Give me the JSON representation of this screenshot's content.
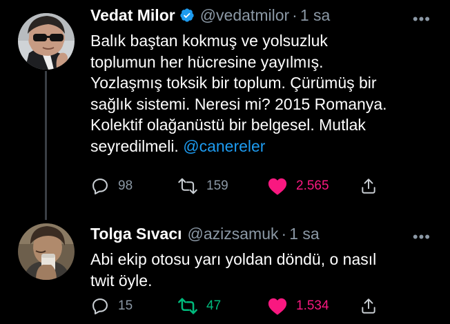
{
  "tweets": [
    {
      "name": "Vedat Milor",
      "handle": "@vedatmilor",
      "separator": "·",
      "time": "1 sa",
      "more": "•••",
      "body_lines": [
        "Balık baştan kokmuş ve yolsuzluk",
        "toplumun her hücresine yayılmış.",
        "Yozlaşmış toksik bir toplum. Çürümüş bir",
        "sağlık sistemi. Neresi mi? 2015 Romanya.",
        "Kolektif olağanüstü bir belgesel. Mutlak"
      ],
      "last_line_text": "seyredilmeli.",
      "mention": "@canereler",
      "replies": "98",
      "retweets": "159",
      "likes": "2.565",
      "verified": true,
      "avatar_icon": "profile-photo-man-sunglasses"
    },
    {
      "name": "Tolga Sıvacı",
      "handle": "@azizsamuk",
      "separator": "·",
      "time": "1 sa",
      "more": "•••",
      "body_lines": [
        "Abi ekip otosu yarı yoldan döndü, o nasıl",
        "twit öyle."
      ],
      "replies": "15",
      "retweets": "47",
      "likes": "1.534",
      "verified": false,
      "avatar_icon": "profile-photo-man-drinking"
    }
  ],
  "colors": {
    "background": "#000000",
    "text": "#ffffff",
    "muted": "#8b98a5",
    "link": "#1d9bf0",
    "like": "#f91880",
    "retweet": "#00ba7c",
    "verified": "#1d9bf0"
  }
}
